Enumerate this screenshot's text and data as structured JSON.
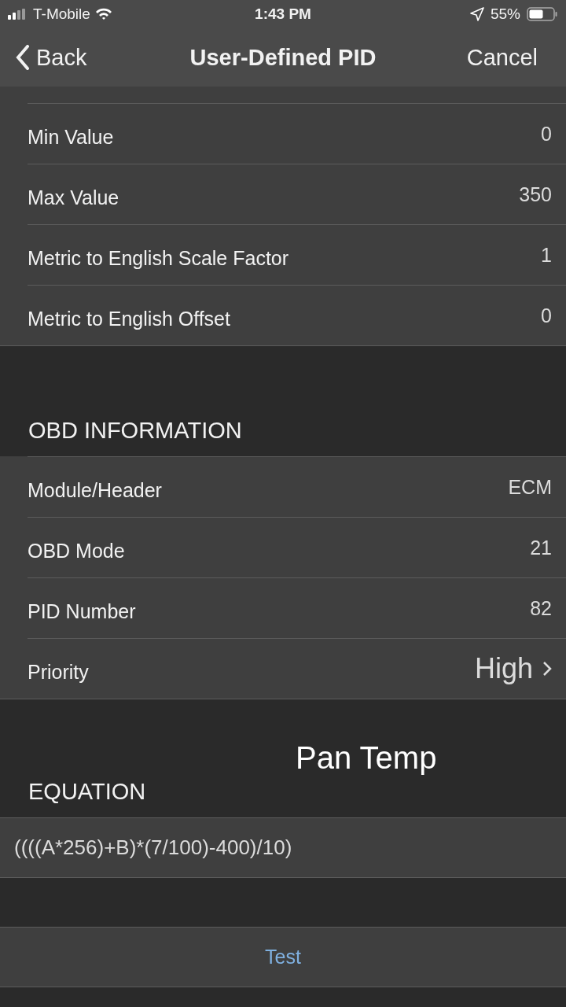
{
  "status_bar": {
    "carrier": "T-Mobile",
    "time": "1:43 PM",
    "battery": "55%"
  },
  "nav": {
    "back": "Back",
    "title": "User-Defined PID",
    "cancel": "Cancel"
  },
  "sections": [
    {
      "rows": [
        {
          "kind": "value",
          "label": "Min Value",
          "value": "0"
        },
        {
          "kind": "value",
          "label": "Max Value",
          "value": "350"
        },
        {
          "kind": "value",
          "label": "Metric to English Scale Factor",
          "value": "1"
        },
        {
          "kind": "value",
          "label": "Metric to English Offset",
          "value": "0"
        }
      ]
    },
    {
      "header": "OBD INFORMATION",
      "rows": [
        {
          "kind": "value",
          "label": "Module/Header",
          "value": "ECM"
        },
        {
          "kind": "value",
          "label": "OBD Mode",
          "value": "21"
        },
        {
          "kind": "value",
          "label": "PID Number",
          "value": "82"
        },
        {
          "kind": "disclosure",
          "label": "Priority",
          "value": "High"
        }
      ]
    }
  ],
  "overlay_label": "Pan Temp",
  "equation": {
    "header": "EQUATION",
    "value": "((((A*256)+B)*(7/100)-400)/10)"
  },
  "test_button": "Test"
}
